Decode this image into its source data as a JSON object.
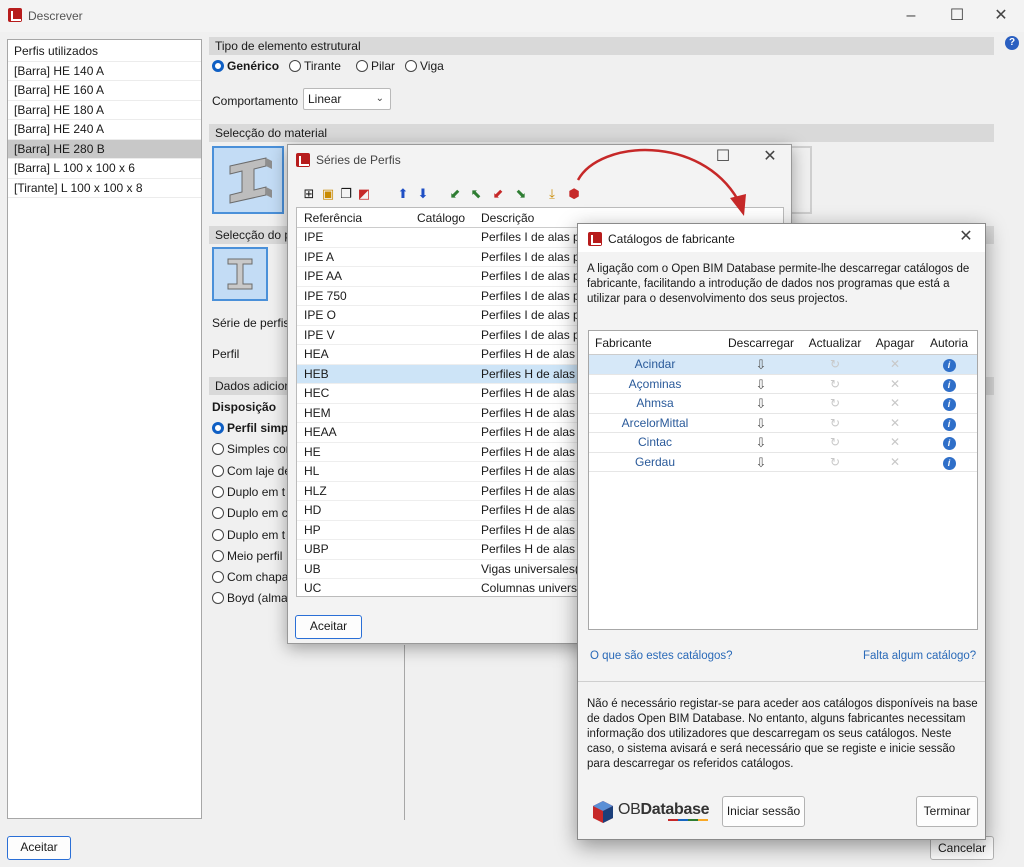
{
  "window": {
    "title": "Descrever",
    "minimize": "–",
    "maximize": "☐",
    "close": "✕"
  },
  "left_panel": {
    "header": "Perfis utilizados",
    "items": [
      {
        "label": "[Barra] HE 140 A",
        "selected": false
      },
      {
        "label": "[Barra] HE 160 A",
        "selected": false
      },
      {
        "label": "[Barra] HE 180 A",
        "selected": false
      },
      {
        "label": "[Barra] HE 240 A",
        "selected": false
      },
      {
        "label": "[Barra] HE 280 B",
        "selected": true
      },
      {
        "label": "[Barra] L 100 x 100 x 6",
        "selected": false
      },
      {
        "label": "[Tirante] L 100 x 100 x 8",
        "selected": false
      }
    ]
  },
  "tipo": {
    "title": "Tipo de elemento estrutural",
    "options": [
      "Genérico",
      "Tirante",
      "Pilar",
      "Viga"
    ],
    "selected": "Genérico"
  },
  "comportamento": {
    "label": "Comportamento",
    "value": "Linear"
  },
  "material": {
    "title": "Selecção do material"
  },
  "perfil_section": {
    "title": "Selecção do p",
    "serie_label": "Série de perfis",
    "perfil_label": "Perfil"
  },
  "dados": {
    "title": "Dados adicion",
    "disposicao_label": "Disposição",
    "options": [
      {
        "label": "Perfil simpl",
        "selected": true
      },
      {
        "label": "Simples cor",
        "selected": false
      },
      {
        "label": "Com laje de",
        "selected": false
      },
      {
        "label": "Duplo em t",
        "selected": false
      },
      {
        "label": "Duplo em c",
        "selected": false
      },
      {
        "label": "Duplo em t",
        "selected": false
      },
      {
        "label": "Meio perfil",
        "selected": false
      },
      {
        "label": "Com chapa",
        "selected": false
      },
      {
        "label": "Boyd (alma",
        "selected": false
      }
    ]
  },
  "footer": {
    "accept": "Aceitar",
    "cancel": "Cancelar"
  },
  "series_dialog": {
    "title": "Séries de Perfis",
    "columns": [
      "Referência",
      "Catálogo",
      "Descrição"
    ],
    "rows": [
      {
        "ref": "IPE",
        "cat": "",
        "desc": "Perfiles I de alas pa"
      },
      {
        "ref": "IPE A",
        "cat": "",
        "desc": "Perfiles I de alas pa"
      },
      {
        "ref": "IPE AA",
        "cat": "",
        "desc": "Perfiles I de alas pa"
      },
      {
        "ref": "IPE 750",
        "cat": "",
        "desc": "Perfiles I de alas pa"
      },
      {
        "ref": "IPE O",
        "cat": "",
        "desc": "Perfiles I de alas pa"
      },
      {
        "ref": "IPE V",
        "cat": "",
        "desc": "Perfiles I de alas pa"
      },
      {
        "ref": "HEA",
        "cat": "",
        "desc": "Perfiles H de alas an"
      },
      {
        "ref": "HEB",
        "cat": "",
        "desc": "Perfiles H de alas an"
      },
      {
        "ref": "HEC",
        "cat": "",
        "desc": "Perfiles H de alas an"
      },
      {
        "ref": "HEM",
        "cat": "",
        "desc": "Perfiles H de alas an"
      },
      {
        "ref": "HEAA",
        "cat": "",
        "desc": "Perfiles H de alas an"
      },
      {
        "ref": "HE",
        "cat": "",
        "desc": "Perfiles H de alas an"
      },
      {
        "ref": "HL",
        "cat": "",
        "desc": "Perfiles H de alas m"
      },
      {
        "ref": "HLZ",
        "cat": "",
        "desc": "Perfiles H de alas m"
      },
      {
        "ref": "HD",
        "cat": "",
        "desc": "Perfiles H de alas an"
      },
      {
        "ref": "HP",
        "cat": "",
        "desc": "Perfiles H de alas an"
      },
      {
        "ref": "UBP",
        "cat": "",
        "desc": "Perfiles H de alas an"
      },
      {
        "ref": "UB",
        "cat": "",
        "desc": "Vigas universales(El"
      },
      {
        "ref": "UC",
        "cat": "",
        "desc": "Columnas universa"
      }
    ],
    "selected_ref": "HEB",
    "accept": "Aceitar"
  },
  "catalog_dialog": {
    "title": "Catálogos de fabricante",
    "intro": "A ligação com o Open BIM Database permite-lhe descarregar catálogos de fabricante, facilitando a introdução de dados nos programas que está a utilizar para o desenvolvimento dos seus projectos.",
    "columns": [
      "Fabricante",
      "Descarregar",
      "Actualizar",
      "Apagar",
      "Autoria"
    ],
    "manufacturers": [
      "Acindar",
      "Açominas",
      "Ahmsa",
      "ArcelorMittal",
      "Cintac",
      "Gerdau"
    ],
    "link_left": "O que são estes catálogos?",
    "link_right": "Falta algum catálogo?",
    "note": "Não é necessário registar-se para aceder aos catálogos disponíveis na base de dados Open BIM Database. No entanto, alguns fabricantes necessitam informação dos utilizadores que descarregam os seus catálogos. Neste caso, o sistema avisará e será necessário que se registe e inicie sessão para descarregar os referidos catálogos.",
    "logo_prefix": "OB",
    "logo_word": "Database",
    "login": "Iniciar sessão",
    "finish": "Terminar",
    "close": "✕"
  },
  "colors": {
    "accent": "#0f5fc4",
    "selection": "#cde4f7",
    "arrow": "#c62828"
  }
}
